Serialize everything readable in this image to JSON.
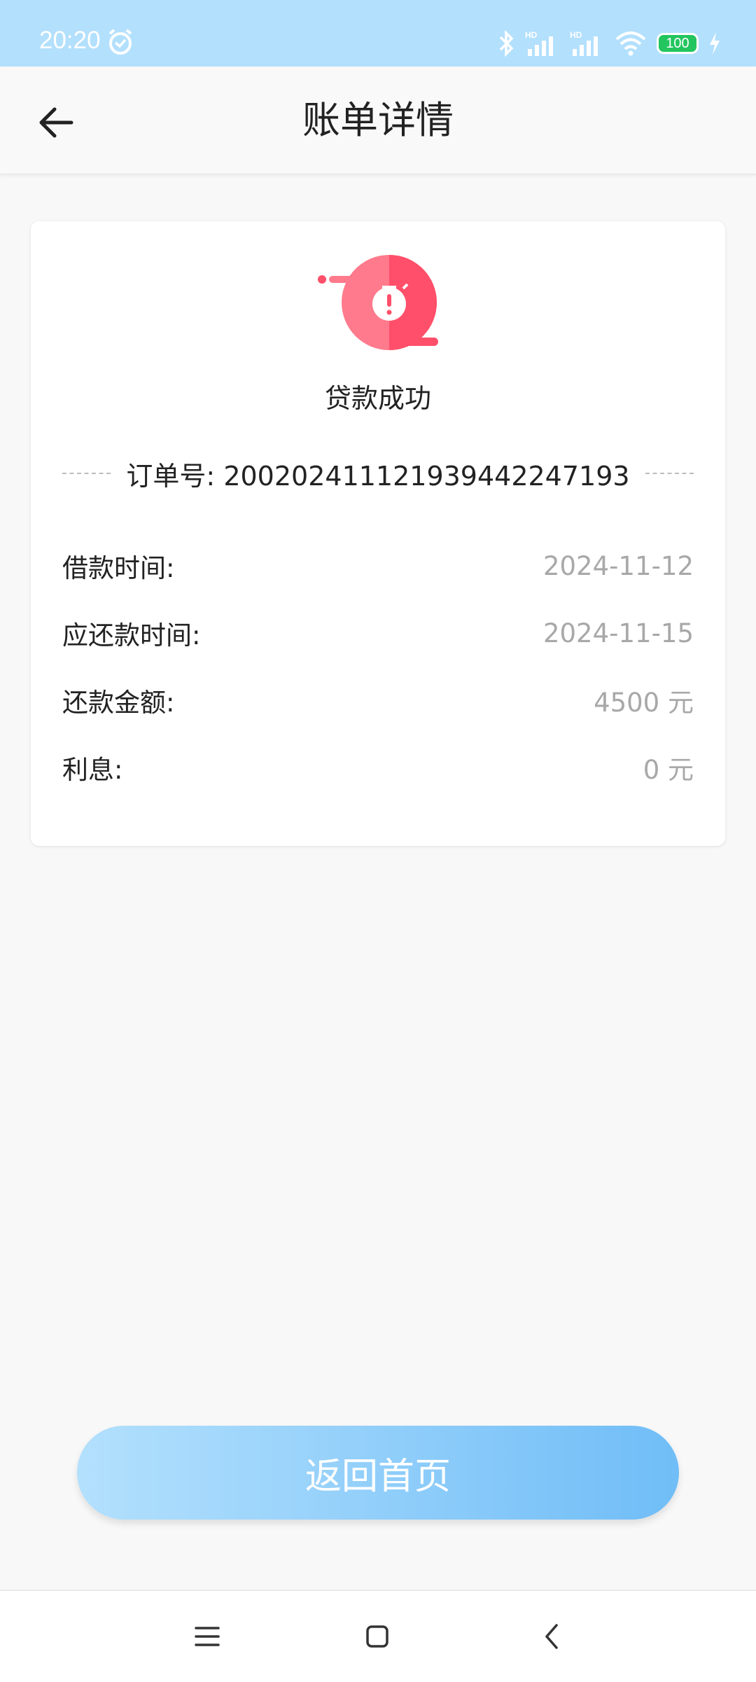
{
  "status_bar": {
    "time": "20:20",
    "battery": "100",
    "icons": [
      "alarm-icon",
      "bluetooth-icon",
      "signal-hd-icon",
      "signal-hd-icon",
      "wifi-icon",
      "battery-icon",
      "charging-icon"
    ]
  },
  "header": {
    "title": "账单详情",
    "back_icon": "arrow-left-icon"
  },
  "card": {
    "status_icon": "stopwatch-alert-icon",
    "status_text": "贷款成功",
    "order_label": "订单号:",
    "order_number": "20020241112193944224719​3",
    "rows": [
      {
        "label": "借款时间:",
        "value": "2024-11-12"
      },
      {
        "label": "应还款时间:",
        "value": "2024-11-15"
      },
      {
        "label": "还款金额:",
        "value": "4500 元"
      },
      {
        "label": "利息:",
        "value": "0 元"
      }
    ]
  },
  "home_button": {
    "label": "返回首页"
  },
  "nav_bar": {
    "icons": [
      "menu-icon",
      "home-square-icon",
      "back-chevron-icon"
    ]
  },
  "colors": {
    "status_bar_bg": "#b3e0fd",
    "accent_red": "#ff4f6a",
    "button_gradient_start": "#b3e0fd",
    "button_gradient_end": "#70bdf7",
    "value_gray": "#a8a8a8"
  }
}
